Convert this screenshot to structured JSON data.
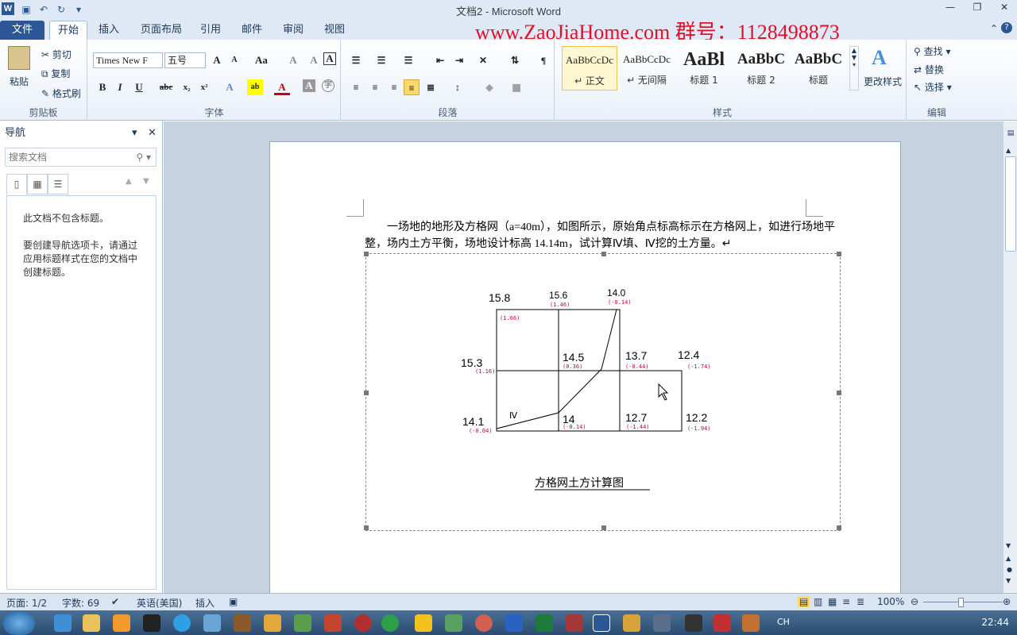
{
  "titlebar": {
    "title": "文档2 - Microsoft Word"
  },
  "watermark": {
    "text": "www.ZaoJiaHome.com 群号：1128498873"
  },
  "tabs": [
    "文件",
    "开始",
    "插入",
    "页面布局",
    "引用",
    "邮件",
    "审阅",
    "视图"
  ],
  "clipboard": {
    "paste": "粘贴",
    "cut": "剪切",
    "copy": "复制",
    "painter": "格式刷",
    "label": "剪贴板"
  },
  "font": {
    "name": "Times New F",
    "size": "五号",
    "label": "字体"
  },
  "paragraph": {
    "label": "段落"
  },
  "styles": {
    "items": [
      {
        "preview": "AaBbCcDc",
        "name": "↵ 正文"
      },
      {
        "preview": "AaBbCcDc",
        "name": "↵ 无间隔"
      },
      {
        "preview": "AaBl",
        "name": "标题 1"
      },
      {
        "preview": "AaBbC",
        "name": "标题 2"
      },
      {
        "preview": "AaBbC",
        "name": "标题"
      }
    ],
    "change": "更改样式",
    "label": "样式"
  },
  "editing": {
    "find": "查找",
    "replace": "替换",
    "select": "选择",
    "label": "编辑"
  },
  "nav": {
    "title": "导航",
    "search_placeholder": "搜索文档",
    "no_headings": "此文档不包含标题。",
    "hint": "要创建导航选项卡，请通过应用标题样式在您的文档中创建标题。"
  },
  "document": {
    "line1": "一场地的地形及方格网（a=40m），如图所示，原始角点标高标示在方格网上，如进行场地平",
    "line2": "整，场内土方平衡，场地设计标高 14.14m，试计算Ⅳ填、Ⅳ挖的土方量。↵"
  },
  "figure": {
    "caption": "方格网土方计算图",
    "points": [
      {
        "elev": "15.8",
        "diff": "(1.66)"
      },
      {
        "elev": "15.6",
        "diff": "(1.46)"
      },
      {
        "elev": "14.0",
        "diff": "(-0.14)"
      },
      {
        "elev": "15.3",
        "diff": "(1.16)"
      },
      {
        "elev": "14.5",
        "diff": "(0.36)"
      },
      {
        "elev": "13.7",
        "diff": "(-0.44)"
      },
      {
        "elev": "12.4",
        "diff": "(-1.74)"
      },
      {
        "elev": "14.1",
        "diff": "(-0.04)"
      },
      {
        "elev": "14",
        "diff": "(-0.14)"
      },
      {
        "elev": "12.7",
        "diff": "(-1.44)"
      },
      {
        "elev": "12.2",
        "diff": "(-1.94)"
      }
    ],
    "cell_mark": "Ⅳ"
  },
  "status": {
    "page": "页面: 1/2",
    "words": "字数: 69",
    "lang": "英语(美国)",
    "mode": "插入",
    "zoom": "100%"
  },
  "clock": "22:44",
  "tray_lang": "CH"
}
